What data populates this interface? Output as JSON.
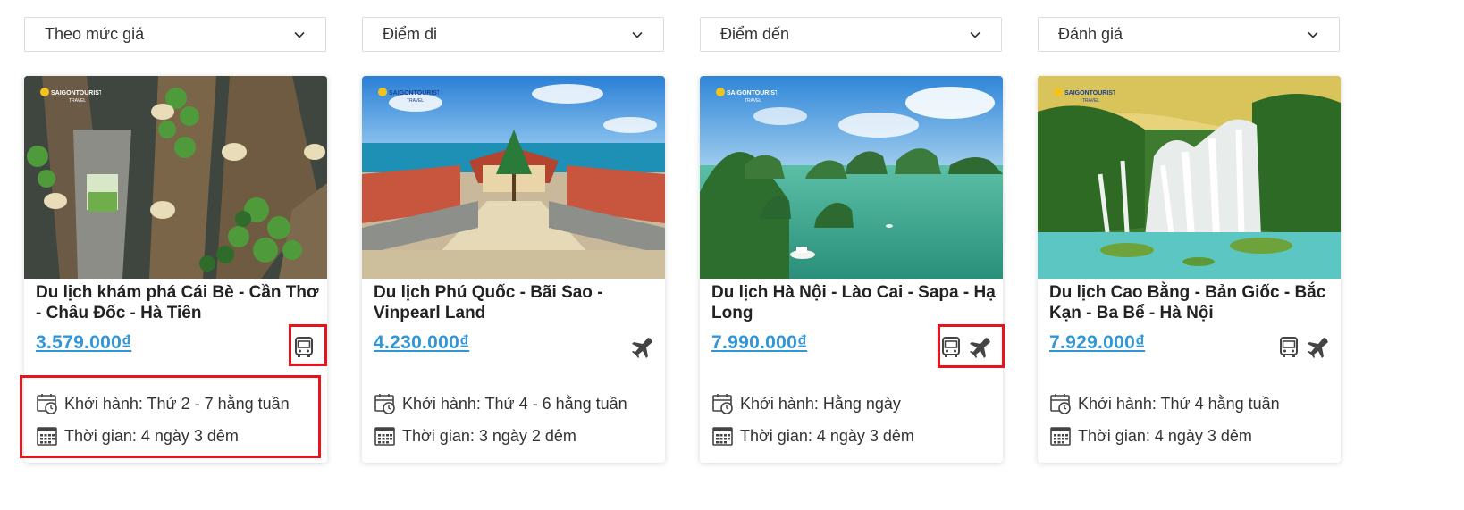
{
  "filters": [
    {
      "label": "Theo mức giá"
    },
    {
      "label": "Điểm đi"
    },
    {
      "label": "Điểm đến"
    },
    {
      "label": "Đánh giá"
    }
  ],
  "tours": [
    {
      "title": "Du lịch khám phá Cái Bè - Cần Thơ - Châu Đốc - Hà Tiên",
      "price": "3.579.000₫",
      "transport": [
        "bus"
      ],
      "departure": "Khởi hành: Thứ 2 - 7 hằng tuần",
      "duration": "Thời gian: 4 ngày 3 đêm"
    },
    {
      "title": "Du lịch Phú Quốc - Bãi Sao - Vinpearl Land",
      "price": "4.230.000₫",
      "transport": [
        "plane"
      ],
      "departure": "Khởi hành: Thứ 4 - 6 hằng tuần",
      "duration": "Thời gian: 3 ngày 2 đêm"
    },
    {
      "title": "Du lịch Hà Nội - Lào Cai - Sapa - Hạ Long",
      "price": "7.990.000₫",
      "transport": [
        "bus",
        "plane"
      ],
      "departure": "Khởi hành: Hằng ngày",
      "duration": "Thời gian: 4 ngày 3 đêm"
    },
    {
      "title": "Du lịch Cao Bằng - Bản Giốc - Bắc Kạn - Ba Bể - Hà Nội",
      "price": "7.929.000₫",
      "transport": [
        "bus",
        "plane"
      ],
      "departure": "Khởi hành: Thứ 4 hằng tuần",
      "duration": "Thời gian: 4 ngày 3 đêm"
    }
  ],
  "colors": {
    "price": "#3096d8",
    "highlight": "#e8131b",
    "icon": "#444444"
  },
  "logo_text": "SAIGONTOURIST TRAVEL"
}
